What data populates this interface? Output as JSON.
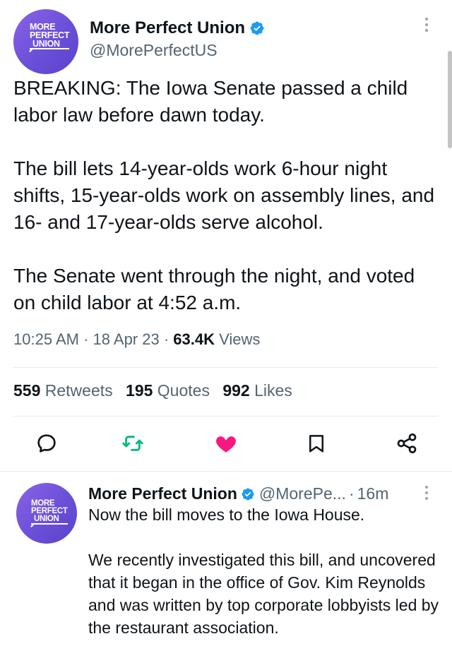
{
  "main_tweet": {
    "avatar_text": [
      "MORE",
      "PERFECT",
      "UNION"
    ],
    "display_name": "More Perfect Union",
    "verified_icon": "verified-badge-icon",
    "handle": "@MorePerfectUS",
    "more_icon": "more-vertical-icon",
    "paragraphs": [
      "BREAKING: The Iowa Senate passed a child labor law before dawn today.",
      "The bill lets 14-year-olds work 6-hour night shifts, 15-year-olds work on assembly lines, and 16- and 17-year-olds serve alcohol.",
      "The Senate went through the night, and voted on child labor at 4:52 a.m."
    ],
    "time": "10:25 AM",
    "date": "18 Apr 23",
    "views_count": "63.4K",
    "views_label": "Views",
    "separator": "·",
    "stats": {
      "retweets_count": "559",
      "retweets_label": "Retweets",
      "quotes_count": "195",
      "quotes_label": "Quotes",
      "likes_count": "992",
      "likes_label": "Likes"
    },
    "actions": [
      {
        "icon": "reply-icon"
      },
      {
        "icon": "retweet-icon",
        "color": "#00ba7c"
      },
      {
        "icon": "like-icon",
        "color": "#f91880"
      },
      {
        "icon": "bookmark-icon"
      },
      {
        "icon": "share-icon"
      }
    ]
  },
  "reply_tweet": {
    "avatar_text": [
      "MORE",
      "PERFECT",
      "UNION"
    ],
    "display_name": "More Perfect Union",
    "handle": "@MorePe...",
    "separator": "·",
    "time": "16m",
    "paragraphs": [
      "Now the bill moves to the Iowa House.",
      "We recently investigated this bill, and uncovered that it began in the office of Gov. Kim Reynolds and was written by top corporate lobbyists led by the restaurant association."
    ]
  },
  "colors": {
    "verified": "#1d9bf0",
    "avatar": "#7b57e0",
    "retweet": "#00ba7c",
    "like": "#f91880",
    "secondary_text": "#536471"
  }
}
